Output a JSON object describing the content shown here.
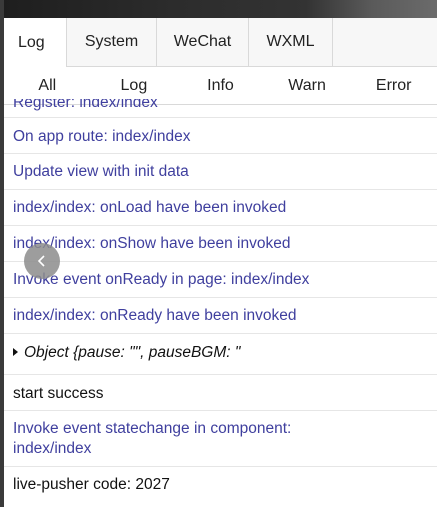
{
  "main_tabs": [
    "Log",
    "System",
    "WeChat",
    "WXML"
  ],
  "filter_tabs": [
    "All",
    "Log",
    "Info",
    "Warn",
    "Error"
  ],
  "logs": [
    {
      "text": "Register: index/index"
    },
    {
      "text": "On app route: index/index"
    },
    {
      "text": "Update view with init data"
    },
    {
      "text": "index/index: onLoad have been invoked"
    },
    {
      "text": "index/index: onShow have been invoked"
    },
    {
      "text": "Invoke event onReady in page: index/index"
    },
    {
      "text": "index/index: onReady have been invoked"
    },
    {
      "text": "Object {pause: \"\", pauseBGM: \""
    },
    {
      "text": "start success"
    },
    {
      "text": "Invoke event statechange in component:",
      "text2": "index/index"
    },
    {
      "text": "live-pusher code: 2027"
    }
  ],
  "colors": {
    "info_text": "#3f3f9e",
    "log_text": "#111111",
    "overlay_button": "#8c8c8c"
  },
  "icons": {
    "back": "chevron-left-icon",
    "expand": "caret-right-icon"
  }
}
